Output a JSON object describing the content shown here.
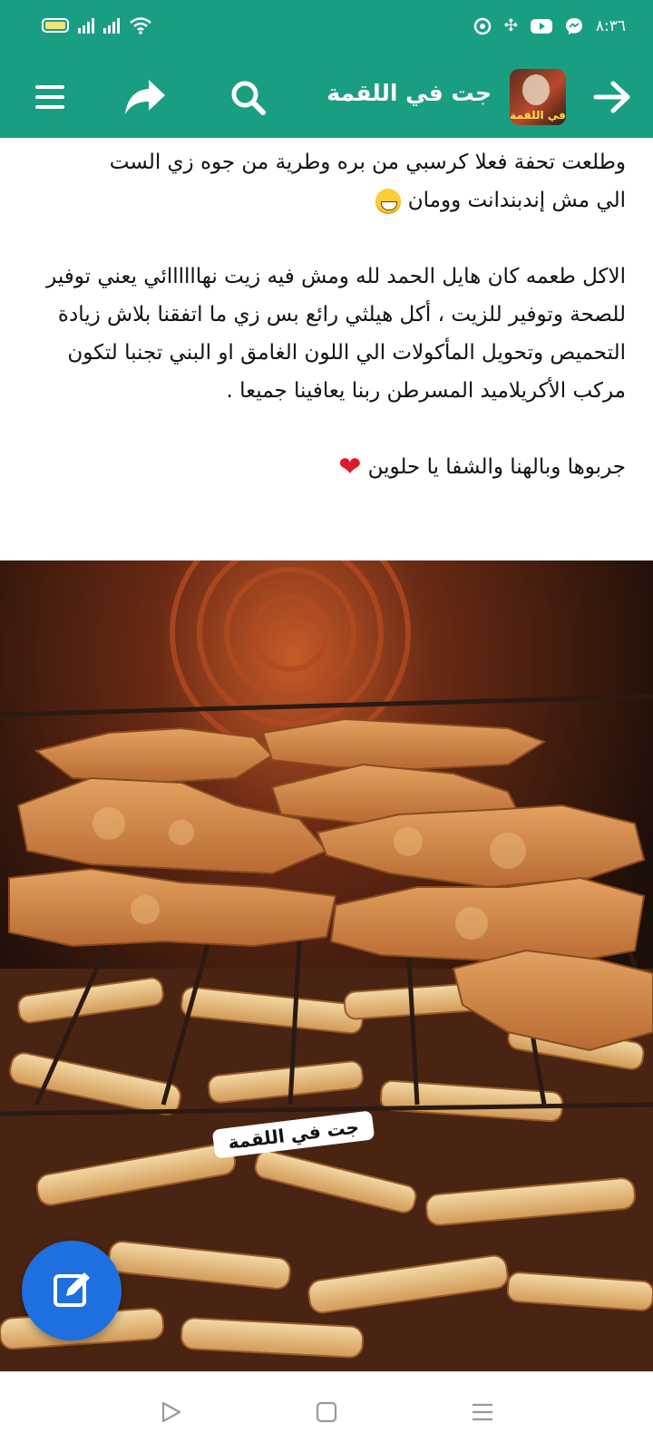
{
  "status_bar": {
    "time": "٨:٣٦",
    "left_icons": [
      "battery-icon",
      "signal-icon",
      "signal-icon",
      "wifi-icon"
    ],
    "right_icons": [
      "chrome-icon",
      "pinwheel-icon",
      "youtube-icon",
      "messenger-icon"
    ]
  },
  "app_bar": {
    "title": "جت في اللقمة",
    "logo_text": "في اللقمة",
    "icons": [
      "menu-icon",
      "share-icon",
      "search-icon",
      "arrow-right-icon"
    ],
    "color": "#1a9e82"
  },
  "post": {
    "paragraph_1_line_1": "وطلعت تحفة فعلا كرسبي من بره وطرية من جوه زي الست",
    "paragraph_1_line_2": "الي مش  إندبندانت وومان",
    "paragraph_2": "الاكل طعمه كان هايل الحمد لله ومش فيه زيت نهاااااائي يعني توفير للصحة وتوفير للزيت ،  أكل هيلثي رائع بس زي ما اتفقنا بلاش زيادة التحميص وتحويل المأكولات الي اللون الغامق او البني تجنبا لتكون مركب الأكريلاميد المسرطن ربنا يعافينا جميعا .",
    "paragraph_3": "جربوها وبالهنا والشفا يا حلوين",
    "emoji_1": "grinning-face",
    "emoji_2": "red-heart"
  },
  "photo": {
    "description_icon": "food-photo",
    "watermark": "جت في اللقمة"
  },
  "fab": {
    "icon": "edit-icon",
    "color": "#1e6fe0"
  },
  "nav_bar": {
    "icons": [
      "nav-back-icon",
      "nav-home-icon",
      "nav-recents-icon"
    ]
  }
}
